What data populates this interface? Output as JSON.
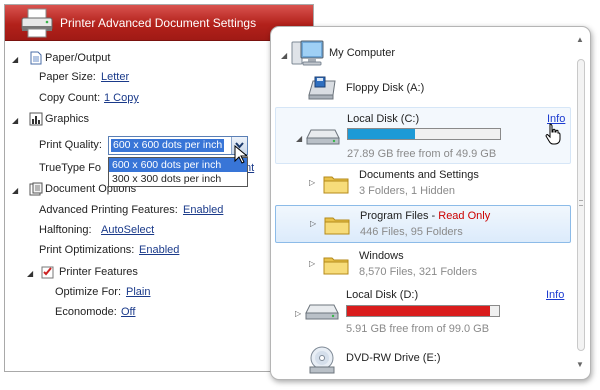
{
  "printer": {
    "title": "Printer Advanced Document Settings",
    "paper_output": {
      "label": "Paper/Output",
      "paper_size_label": "Paper Size:",
      "paper_size_value": "Letter",
      "copy_count_label": "Copy Count:",
      "copy_count_value": "1 Copy"
    },
    "graphics": {
      "label": "Graphics",
      "print_quality_label": "Print Quality:",
      "print_quality_value": "600 x 600 dots per inch",
      "print_quality_options": [
        "600 x 600 dots per inch",
        "300 x 300 dots per inch"
      ],
      "truetype_label": "TrueType Fo"
    },
    "document_options": {
      "label": "Document Options",
      "advanced_label": "Advanced Printing Features:",
      "advanced_value": "Enabled",
      "halftoning_label": "Halftoning:",
      "halftoning_value": "AutoSelect",
      "optimizations_label": "Print Optimizations:",
      "optimizations_value": "Enabled",
      "printer_features": {
        "label": "Printer Features",
        "optimize_label": "Optimize For:",
        "optimize_value": "Plain",
        "economode_label": "Economode:",
        "economode_value": "Off"
      }
    }
  },
  "explorer": {
    "root": "My Computer",
    "items": [
      {
        "name": "Floppy Disk (A:)"
      },
      {
        "name": "Local Disk (C:)",
        "free": "27.89 GB free from of 49.9 GB",
        "used_fraction": 0.44,
        "bar_color": "#1d9ad6",
        "link": "Info"
      },
      {
        "name": "Documents and Settings",
        "detail": "3 Folders, 1 Hidden"
      },
      {
        "name": "Program Files",
        "badge_sep": " - ",
        "badge": "Read Only",
        "detail": "446 Files, 95 Folders"
      },
      {
        "name": "Windows",
        "detail": "8,570 Files, 321 Folders"
      },
      {
        "name": "Local Disk (D:)",
        "free": "5.91 GB free from of 99.0 GB",
        "used_fraction": 0.94,
        "bar_color": "#d91c1c",
        "link": "Info"
      },
      {
        "name": "DVD-RW Drive (E:)"
      }
    ]
  },
  "icons": [
    "printer-icon",
    "page-icon",
    "chart-icon",
    "document-options-icon",
    "checklist-icon",
    "computer-icon",
    "floppy-drive-icon",
    "hard-disk-icon",
    "folder-icon",
    "dvd-drive-icon",
    "hand-cursor-icon",
    "arrow-cursor-icon"
  ]
}
